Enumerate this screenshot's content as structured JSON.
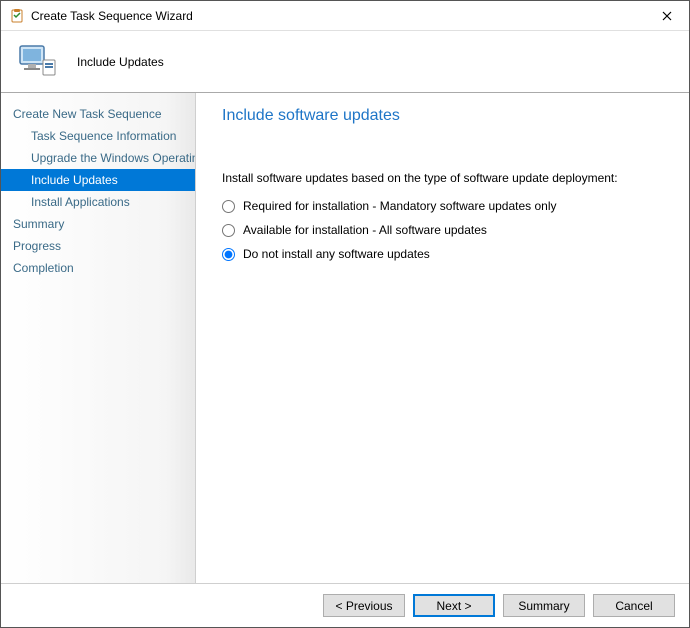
{
  "window": {
    "title": "Create Task Sequence Wizard"
  },
  "header": {
    "page_title": "Include Updates"
  },
  "sidebar": {
    "items": [
      {
        "label": "Create New Task Sequence",
        "level": 0,
        "selected": false
      },
      {
        "label": "Task Sequence Information",
        "level": 1,
        "selected": false
      },
      {
        "label": "Upgrade the Windows Operating System",
        "level": 1,
        "selected": false
      },
      {
        "label": "Include Updates",
        "level": 1,
        "selected": true
      },
      {
        "label": "Install Applications",
        "level": 1,
        "selected": false
      },
      {
        "label": "Summary",
        "level": 0,
        "selected": false
      },
      {
        "label": "Progress",
        "level": 0,
        "selected": false
      },
      {
        "label": "Completion",
        "level": 0,
        "selected": false
      }
    ]
  },
  "main": {
    "heading": "Include software updates",
    "instruction": "Install software updates based on the type of software update deployment:",
    "options": [
      {
        "label": "Required for installation - Mandatory software updates only",
        "selected": false
      },
      {
        "label": "Available for installation - All software updates",
        "selected": false
      },
      {
        "label": "Do not install any software updates",
        "selected": true
      }
    ]
  },
  "footer": {
    "previous": "< Previous",
    "next": "Next >",
    "summary": "Summary",
    "cancel": "Cancel"
  }
}
